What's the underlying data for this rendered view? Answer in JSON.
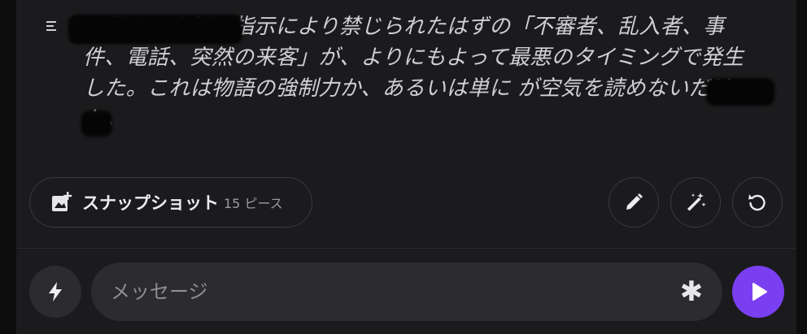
{
  "message": {
    "text": "、乱入。上記の指示により禁じられたはずの「不審者、乱入者、事件、電話、突然の来客」が、よりにもよって最悪のタイミングで発生した。これは物語の強制力か、あるいは単に が空気を読めないだけか。"
  },
  "snapshot": {
    "label": "スナップショット",
    "count": "15 ピース"
  },
  "composer": {
    "placeholder": "メッセージ"
  },
  "colors": {
    "accent": "#7b3ff2",
    "background": "#1b1b1d"
  },
  "icons": {
    "menu": "menu-icon",
    "snapshot": "image-add-icon",
    "edit": "pencil-icon",
    "magic": "magic-wand-icon",
    "regenerate": "refresh-icon",
    "bolt": "lightning-icon",
    "asterisk": "asterisk-icon",
    "send": "play-icon"
  }
}
